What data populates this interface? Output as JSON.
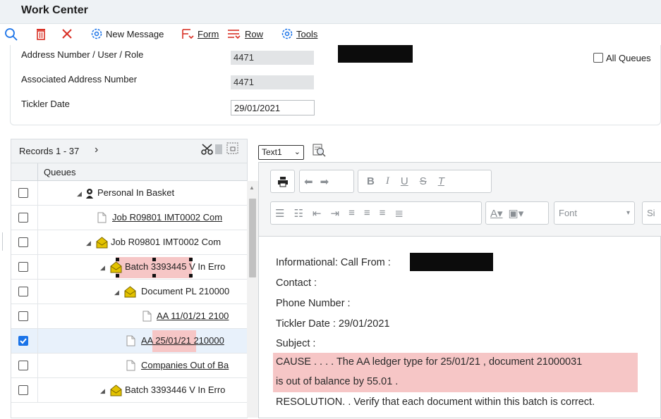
{
  "app": {
    "title": "Work Center"
  },
  "toolbar": {
    "new_message": "New Message",
    "form_label": "Form",
    "row_label": "Row",
    "tools_label": "Tools"
  },
  "header_form": {
    "address_label": "Address Number / User / Role",
    "address_value": "4471",
    "assoc_label": "Associated Address Number",
    "assoc_value": "4471",
    "tickler_label": "Tickler Date",
    "tickler_value": "29/01/2021",
    "all_queues_label": "All Queues",
    "all_queues_checked": false
  },
  "grid": {
    "records_label": "Records 1 - 37",
    "column_header": "Queues",
    "rows": [
      {
        "label": "Personal In Basket",
        "icon": "person-icon",
        "checked": false,
        "link": false
      },
      {
        "label": "Job R09801 IMT0002 Com",
        "icon": "document-icon",
        "checked": false,
        "link": true
      },
      {
        "label": "Job R09801 IMT0002 Com",
        "icon": "envelope-icon",
        "checked": false,
        "link": false
      },
      {
        "label": "Batch 3393445 V In Erro",
        "icon": "envelope-icon",
        "checked": false,
        "link": false
      },
      {
        "label": "Document PL 210000",
        "icon": "envelope-icon",
        "checked": false,
        "link": false
      },
      {
        "label": "AA 11/01/21 2100",
        "icon": "document-icon",
        "checked": false,
        "link": true
      },
      {
        "label": "AA 25/01/21 210000",
        "icon": "document-icon",
        "checked": true,
        "link": true
      },
      {
        "label": "Companies Out of Ba",
        "icon": "document-icon",
        "checked": false,
        "link": true
      },
      {
        "label": "Batch 3393446 V In Erro",
        "icon": "envelope-icon",
        "checked": false,
        "link": false
      }
    ]
  },
  "editor": {
    "text_select": "Text1",
    "font_placeholder": "Font",
    "size_partial": "Si",
    "bold": "B",
    "italic": "I",
    "underline": "U",
    "strike": "S",
    "clear": "T",
    "lines": {
      "l1": "Informational: Call From :",
      "l2": "Contact :",
      "l3": "Phone Number :",
      "l4": "Tickler Date : 29/01/2021",
      "l5": "Subject :",
      "l6": "CAUSE . . . . The AA ledger type for 25/01/21 , document 21000031",
      "l7": "is out of balance by 55.01 .",
      "l8": "RESOLUTION. . Verify that each document within this batch is correct."
    }
  },
  "colors": {
    "highlight": "#f6c6c6",
    "selected_row": "#e8f1fb",
    "checkbox_checked": "#1a73e8",
    "envelope": "#d9b400",
    "delete_red": "#d93025"
  }
}
